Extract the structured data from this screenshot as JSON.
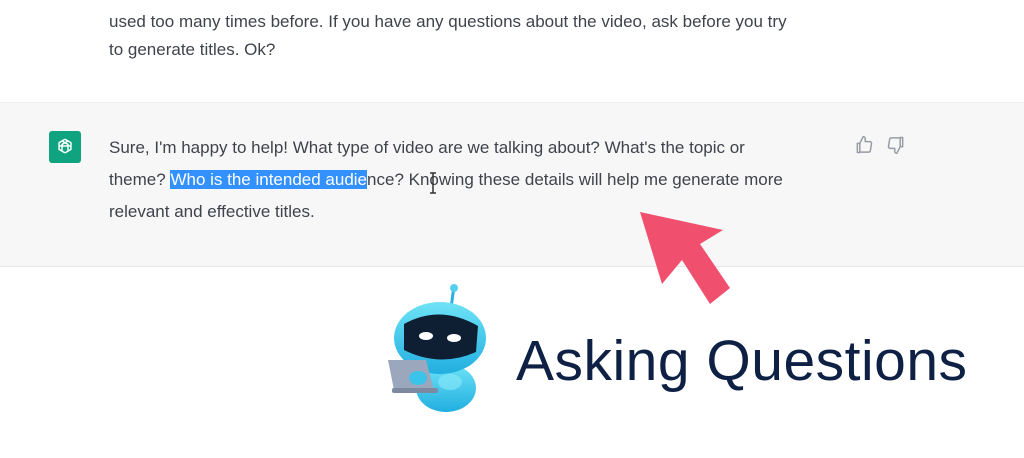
{
  "user_message": {
    "faded_line": "...",
    "lines": [
      "used too many times before. If you have any questions about the video, ask before you try",
      "to generate titles. Ok?"
    ]
  },
  "assistant_message": {
    "line1": "Sure, I'm happy to help! What type of video are we talking about? What's the topic or",
    "line2_before": "theme? ",
    "line2_highlighted": "Who is the intended audie",
    "line2_after": "nce? Knowing these details will help me generate more",
    "line3": "relevant and effective titles."
  },
  "icons": {
    "avatar": "openai-logo-icon",
    "feedback": [
      "thumbs-up-icon",
      "thumbs-down-icon"
    ],
    "overlay": [
      "arrow-icon",
      "robot-mascot-icon"
    ]
  },
  "overlay": {
    "headline": "Asking Questions"
  },
  "colors": {
    "selection": "#3390ff",
    "avatar_bg": "#10a37f",
    "arrow": "#f0506e",
    "headline": "#0e2145"
  }
}
